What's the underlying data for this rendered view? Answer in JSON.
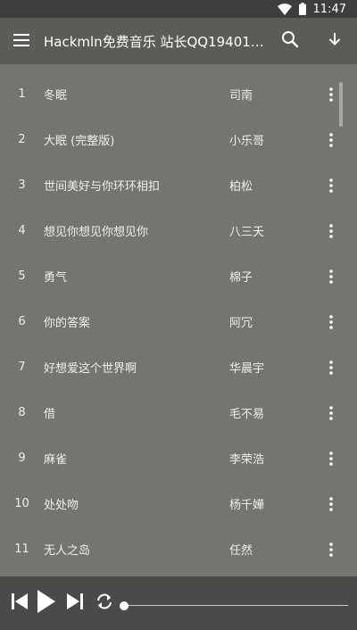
{
  "status_bar": {
    "time": "11:47",
    "wifi_icon": "wifi-icon",
    "battery_icon": "battery-icon"
  },
  "app_bar": {
    "menu_icon": "menu-icon",
    "title": "Hackmln免费音乐 站长QQ194013...",
    "search_icon": "search-icon",
    "download_icon": "download-icon"
  },
  "songs": [
    {
      "num": "1",
      "title": "冬眠",
      "artist": "司南"
    },
    {
      "num": "2",
      "title": "大眠 (完整版)",
      "artist": "小乐哥"
    },
    {
      "num": "3",
      "title": "世间美好与你环环相扣",
      "artist": "柏松"
    },
    {
      "num": "4",
      "title": "想见你想见你想见你",
      "artist": "八三夭"
    },
    {
      "num": "5",
      "title": "勇气",
      "artist": "棉子"
    },
    {
      "num": "6",
      "title": "你的答案",
      "artist": "阿冗"
    },
    {
      "num": "7",
      "title": "好想爱这个世界啊",
      "artist": "华晨宇"
    },
    {
      "num": "8",
      "title": "借",
      "artist": "毛不易"
    },
    {
      "num": "9",
      "title": "麻雀",
      "artist": "李荣浩"
    },
    {
      "num": "10",
      "title": "处处吻",
      "artist": "杨千嬅"
    },
    {
      "num": "11",
      "title": "无人之岛",
      "artist": "任然"
    }
  ],
  "player": {
    "prev_icon": "skip-previous-icon",
    "play_icon": "play-icon",
    "next_icon": "skip-next-icon",
    "repeat_icon": "repeat-icon",
    "progress": 0
  },
  "colors": {
    "status_bar": "#3e3f3c",
    "app_bar": "#5b5c58",
    "list_background": "#757570",
    "player_bar": "#4a4b48"
  }
}
